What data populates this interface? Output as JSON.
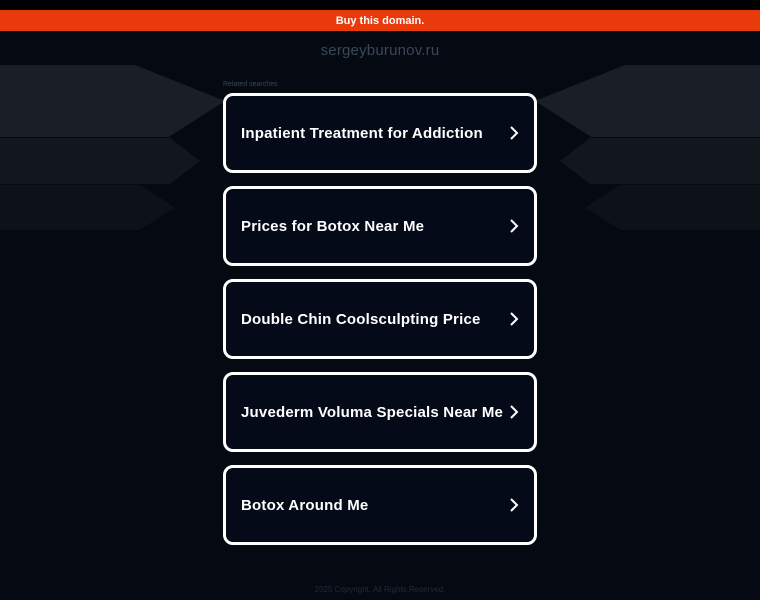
{
  "banner": {
    "label": "Buy this domain."
  },
  "site": {
    "domain": "sergeyburunov.ru"
  },
  "related": {
    "heading": "Related searches"
  },
  "links": [
    {
      "label": "Inpatient Treatment for Addiction"
    },
    {
      "label": "Prices for Botox Near Me"
    },
    {
      "label": "Double Chin Coolsculpting Price"
    },
    {
      "label": "Juvederm Voluma Specials Near Me"
    },
    {
      "label": "Botox Around Me"
    }
  ],
  "footer": {
    "text": "2025 Copyright. All Rights Reserved."
  },
  "colors": {
    "banner": "#e83a0a",
    "background": "#050a12",
    "card_border": "#ffffff"
  },
  "icons": {
    "link_arrow": "chevron-right-icon"
  }
}
